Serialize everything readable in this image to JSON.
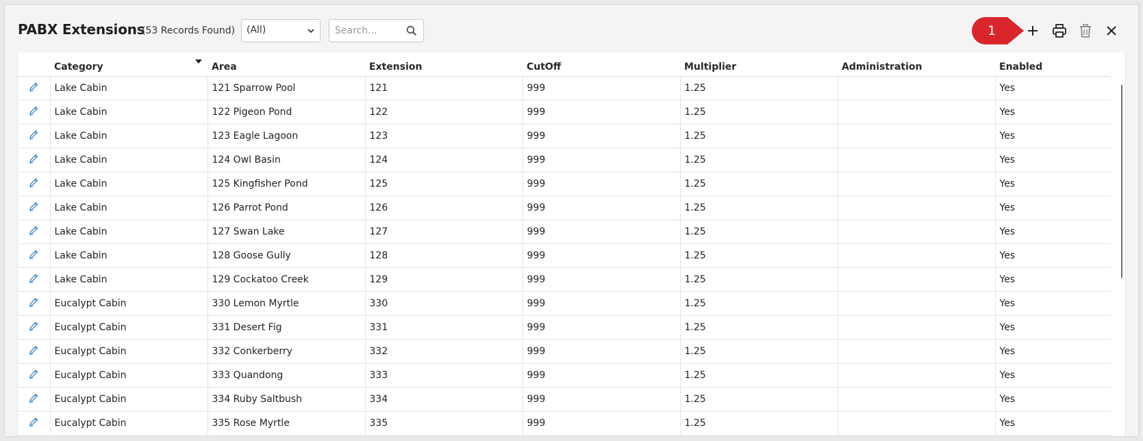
{
  "header": {
    "title": "PABX Extensions",
    "record_count": "(53 Records Found)",
    "filter_value": "(All)",
    "search_placeholder": "Search...",
    "callout_number": "1"
  },
  "toolbar": {
    "icons": [
      "plus-icon",
      "print-icon",
      "trash-icon",
      "close-icon"
    ],
    "callout_color": "#d9262c"
  },
  "table": {
    "columns": [
      "Category",
      "Area",
      "Extension",
      "CutOff",
      "Multiplier",
      "Administration",
      "Enabled"
    ],
    "sorted_column": "Category",
    "rows": [
      [
        "Lake Cabin",
        "121 Sparrow Pool",
        "121",
        "999",
        "1.25",
        "",
        "Yes"
      ],
      [
        "Lake Cabin",
        "122 Pigeon Pond",
        "122",
        "999",
        "1.25",
        "",
        "Yes"
      ],
      [
        "Lake Cabin",
        "123 Eagle Lagoon",
        "123",
        "999",
        "1.25",
        "",
        "Yes"
      ],
      [
        "Lake Cabin",
        "124 Owl Basin",
        "124",
        "999",
        "1.25",
        "",
        "Yes"
      ],
      [
        "Lake Cabin",
        "125 Kingfisher Pond",
        "125",
        "999",
        "1.25",
        "",
        "Yes"
      ],
      [
        "Lake Cabin",
        "126 Parrot Pond",
        "126",
        "999",
        "1.25",
        "",
        "Yes"
      ],
      [
        "Lake Cabin",
        "127 Swan Lake",
        "127",
        "999",
        "1.25",
        "",
        "Yes"
      ],
      [
        "Lake Cabin",
        "128 Goose Gully",
        "128",
        "999",
        "1.25",
        "",
        "Yes"
      ],
      [
        "Lake Cabin",
        "129 Cockatoo Creek",
        "129",
        "999",
        "1.25",
        "",
        "Yes"
      ],
      [
        "Eucalypt Cabin",
        "330 Lemon Myrtle",
        "330",
        "999",
        "1.25",
        "",
        "Yes"
      ],
      [
        "Eucalypt Cabin",
        "331 Desert Fig",
        "331",
        "999",
        "1.25",
        "",
        "Yes"
      ],
      [
        "Eucalypt Cabin",
        "332 Conkerberry",
        "332",
        "999",
        "1.25",
        "",
        "Yes"
      ],
      [
        "Eucalypt Cabin",
        "333 Quandong",
        "333",
        "999",
        "1.25",
        "",
        "Yes"
      ],
      [
        "Eucalypt Cabin",
        "334 Ruby Saltbush",
        "334",
        "999",
        "1.25",
        "",
        "Yes"
      ],
      [
        "Eucalypt Cabin",
        "335 Rose Myrtle",
        "335",
        "999",
        "1.25",
        "",
        "Yes"
      ]
    ]
  }
}
